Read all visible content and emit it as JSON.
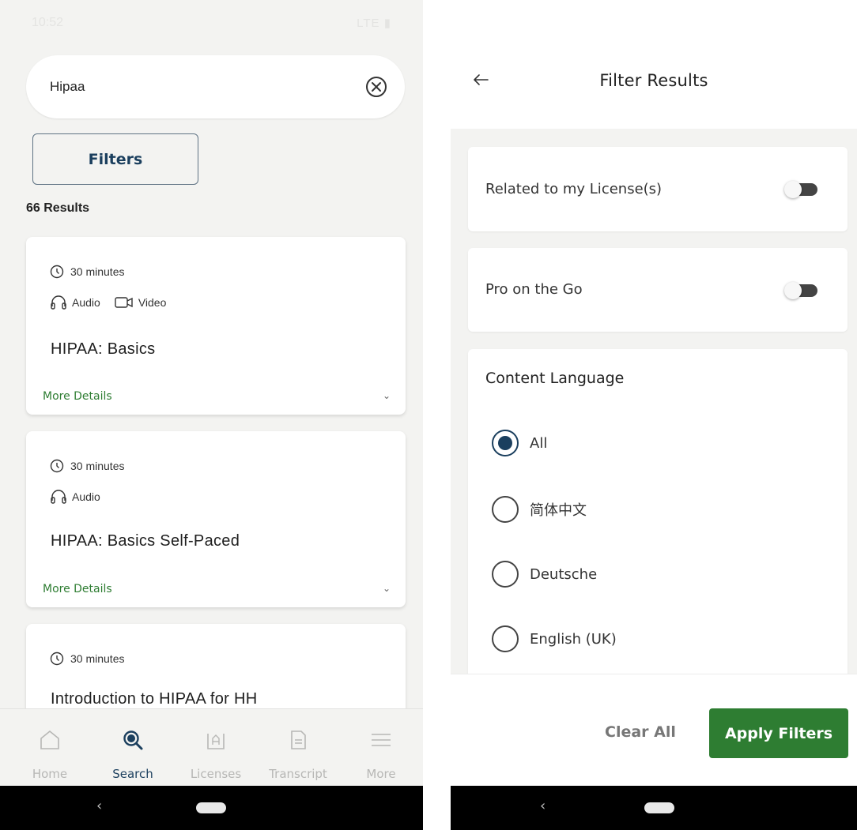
{
  "left_screen": {
    "status_bar": {
      "time": "10:52",
      "icons_text": "LTE"
    },
    "search": {
      "query": "Hipaa"
    },
    "filters_button": "Filters",
    "results_count": "66 Results",
    "cards": [
      {
        "duration": "30 minutes",
        "media": [
          "Audio",
          "Video"
        ],
        "title": "HIPAA: Basics",
        "more": "More Details"
      },
      {
        "duration": "30 minutes",
        "media": [
          "Audio"
        ],
        "title": "HIPAA: Basics Self-Paced",
        "more": "More Details"
      },
      {
        "duration": "30 minutes",
        "media": [],
        "title": "Introduction to HIPAA for HH",
        "more": ""
      }
    ],
    "bottom_nav": [
      {
        "label": "Home",
        "icon": "home-icon",
        "active": false
      },
      {
        "label": "Search",
        "icon": "search-icon",
        "active": true
      },
      {
        "label": "Licenses",
        "icon": "license-icon",
        "active": false
      },
      {
        "label": "Transcript",
        "icon": "transcript-icon",
        "active": false
      },
      {
        "label": "More",
        "icon": "menu-icon",
        "active": false
      }
    ]
  },
  "right_screen": {
    "title": "Filter Results",
    "toggles": [
      {
        "label": "Related to my License(s)",
        "on": false
      },
      {
        "label": "Pro on the Go",
        "on": false
      }
    ],
    "language_section": {
      "title": "Content Language",
      "options": [
        {
          "label": "All",
          "checked": true
        },
        {
          "label": "简体中文",
          "checked": false
        },
        {
          "label": "Deutsche",
          "checked": false
        },
        {
          "label": "English (UK)",
          "checked": false
        }
      ]
    },
    "clear_all": "Clear All",
    "apply_filters": "Apply Filters"
  },
  "colors": {
    "brand_navy": "#1b3f5e",
    "brand_green": "#2e7d32",
    "background": "#f3f3f1"
  }
}
